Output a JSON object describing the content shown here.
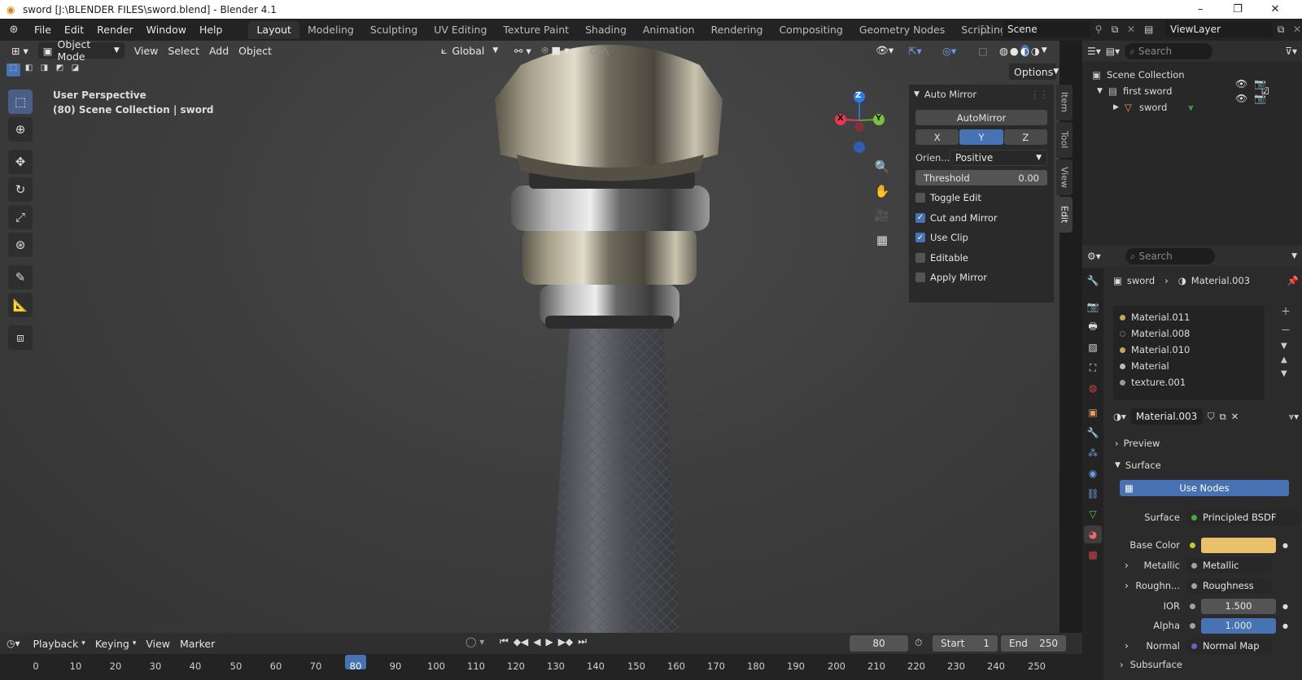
{
  "window": {
    "title": "sword [J:\\BLENDER FILES\\sword.blend] - Blender 4.1"
  },
  "menu": [
    "File",
    "Edit",
    "Render",
    "Window",
    "Help"
  ],
  "workspaces": [
    {
      "label": "Layout",
      "active": true
    },
    {
      "label": "Modeling"
    },
    {
      "label": "Sculpting"
    },
    {
      "label": "UV Editing"
    },
    {
      "label": "Texture Paint"
    },
    {
      "label": "Shading"
    },
    {
      "label": "Animation"
    },
    {
      "label": "Rendering"
    },
    {
      "label": "Compositing"
    },
    {
      "label": "Geometry Nodes"
    },
    {
      "label": "Scripting"
    }
  ],
  "scene": "Scene",
  "view_layer": "ViewLayer",
  "viewport_header": {
    "mode": "Object Mode",
    "menus": [
      "View",
      "Select",
      "Add",
      "Object"
    ],
    "transform_orientation": "Global",
    "options_label": "Options"
  },
  "viewport": {
    "perspective": "User Perspective",
    "info": "(80) Scene Collection | sword",
    "gizmo": {
      "x": "X",
      "y": "Y",
      "z": "Z"
    }
  },
  "n_panel": {
    "section": "Auto Mirror",
    "main_button": "AutoMirror",
    "axes": [
      {
        "label": "X"
      },
      {
        "label": "Y",
        "active": true
      },
      {
        "label": "Z"
      }
    ],
    "orientation_label": "Orien...",
    "orientation_value": "Positive",
    "threshold_label": "Threshold",
    "threshold_value": "0.00",
    "checks": [
      {
        "label": "Toggle Edit",
        "checked": false
      },
      {
        "label": "Cut and Mirror",
        "checked": true
      },
      {
        "label": "Use Clip",
        "checked": true
      },
      {
        "label": "Editable",
        "checked": false
      },
      {
        "label": "Apply Mirror",
        "checked": false
      }
    ],
    "tabs": [
      "Item",
      "Tool",
      "View",
      "Edit"
    ]
  },
  "outliner": {
    "search_placeholder": "Search",
    "root": "Scene Collection",
    "items": [
      {
        "label": "first sword",
        "depth": 1
      },
      {
        "label": "sword",
        "depth": 2
      }
    ]
  },
  "properties": {
    "search_placeholder": "Search",
    "breadcrumb": {
      "object": "sword",
      "material": "Material.003"
    },
    "material_slots": [
      "Material.011",
      "Material.008",
      "Material.010",
      "Material",
      "texture.001"
    ],
    "active_material": "Material.003",
    "sections": {
      "preview": "Preview",
      "surface": "Surface"
    },
    "use_nodes": "Use Nodes",
    "rows": [
      {
        "label": "Surface",
        "value": "Principled BSDF",
        "dot": "#44aa44"
      },
      {
        "label": "Base Color",
        "value": "",
        "dot": "#c7c729",
        "swatch": "#e8c16a"
      },
      {
        "label": "Metallic",
        "value": "Metallic",
        "dot": "#a1a1a1",
        "expand": true
      },
      {
        "label": "Roughn...",
        "value": "Roughness",
        "dot": "#a1a1a1",
        "expand": true
      },
      {
        "label": "IOR",
        "value": "1.500",
        "dot": "#a1a1a1",
        "slider": true
      },
      {
        "label": "Alpha",
        "value": "1.000",
        "dot": "#a1a1a1",
        "slider": true,
        "full": true
      },
      {
        "label": "Normal",
        "value": "Normal Map",
        "dot": "#6363c7",
        "expand": true
      }
    ],
    "subsurface": "Subsurface"
  },
  "timeline": {
    "menus": [
      "Playback",
      "Keying",
      "View",
      "Marker"
    ],
    "current_frame": "80",
    "start_label": "Start",
    "start": "1",
    "end_label": "End",
    "end": "250",
    "ticks": [
      "0",
      "10",
      "20",
      "30",
      "40",
      "50",
      "60",
      "70",
      "80",
      "90",
      "100",
      "110",
      "120",
      "130",
      "140",
      "150",
      "160",
      "170",
      "180",
      "190",
      "200",
      "210",
      "220",
      "230",
      "240",
      "250"
    ]
  },
  "colors": {
    "accent": "#4772b3",
    "base_color": "#e8c16a"
  }
}
